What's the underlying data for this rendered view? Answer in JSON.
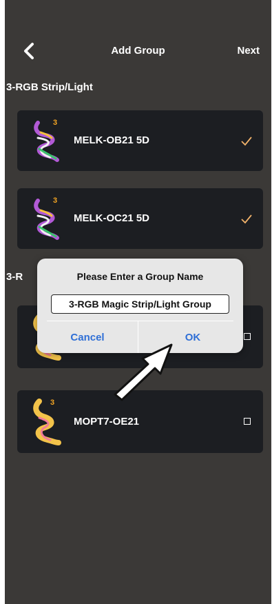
{
  "header": {
    "title": "Add Group",
    "next_label": "Next"
  },
  "sections": [
    {
      "title": "3-RGB Strip/Light"
    },
    {
      "title": "3-R"
    }
  ],
  "devices": [
    {
      "name": "MELK-OB21 5D",
      "badge": "3",
      "selected": true
    },
    {
      "name": "MELK-OC21 5D",
      "badge": "3",
      "selected": true
    },
    {
      "name": "",
      "badge": "",
      "selected": false
    },
    {
      "name": "MOPT7-OE21",
      "badge": "3",
      "selected": false
    }
  ],
  "dialog": {
    "title": "Please Enter a Group Name",
    "input_value": "3-RGB Magic Strip/Light Group",
    "cancel_label": "Cancel",
    "ok_label": "OK"
  },
  "colors": {
    "background": "#3b3937",
    "card": "#1c1e22",
    "check": "#f2b36b",
    "dialog_button": "#2f6fd6",
    "badge": "#f5a623"
  }
}
